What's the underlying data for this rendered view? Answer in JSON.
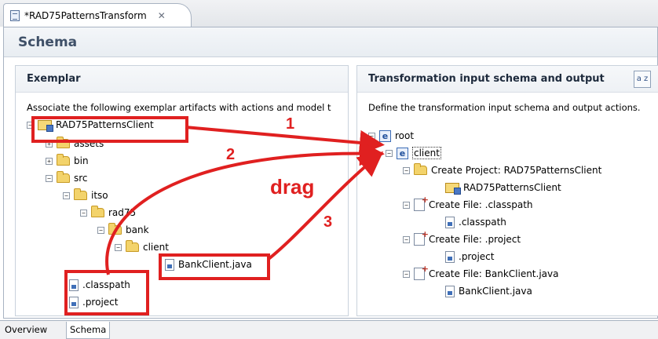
{
  "editor_tab": {
    "title": "*RAD75PatternsTransform",
    "icon": "document-icon",
    "close_glyph": "✕"
  },
  "form": {
    "title": "Schema"
  },
  "left_section": {
    "heading": "Exemplar",
    "description": "Associate the following exemplar artifacts with actions and model t",
    "tree": [
      {
        "label": "RAD75PatternsClient",
        "icon": "project-icon",
        "expander": "−"
      },
      {
        "label": "assets",
        "icon": "folder-icon",
        "expander": "+"
      },
      {
        "label": "bin",
        "icon": "folder-icon",
        "expander": "+"
      },
      {
        "label": "src",
        "icon": "folder-icon",
        "expander": "−"
      },
      {
        "label": "itso",
        "icon": "folder-icon",
        "expander": "−"
      },
      {
        "label": "rad75",
        "icon": "folder-icon",
        "expander": "−"
      },
      {
        "label": "bank",
        "icon": "folder-icon",
        "expander": "−"
      },
      {
        "label": "client",
        "icon": "folder-icon",
        "expander": "−"
      },
      {
        "label": "BankClient.java",
        "icon": "java-file-icon"
      },
      {
        "label": ".classpath",
        "icon": "file-icon"
      },
      {
        "label": ".project",
        "icon": "file-icon"
      }
    ]
  },
  "right_section": {
    "heading": "Transformation input schema and output",
    "sort_button": "a z",
    "description": "Define the transformation input schema and output actions.",
    "tree": [
      {
        "label": "root",
        "icon": "element-icon",
        "expander": "−"
      },
      {
        "label": "client",
        "icon": "element-icon",
        "expander": "−"
      },
      {
        "label": "Create Project: RAD75PatternsClient",
        "icon": "create-project-icon",
        "expander": "−"
      },
      {
        "label": "RAD75PatternsClient",
        "icon": "project-icon"
      },
      {
        "label": "Create File: .classpath",
        "icon": "create-file-icon",
        "expander": "−"
      },
      {
        "label": ".classpath",
        "icon": "file-icon"
      },
      {
        "label": "Create File: .project",
        "icon": "create-file-icon",
        "expander": "−"
      },
      {
        "label": ".project",
        "icon": "file-icon"
      },
      {
        "label": "Create File: BankClient.java",
        "icon": "create-file-icon",
        "expander": "−"
      },
      {
        "label": "BankClient.java",
        "icon": "java-file-icon"
      }
    ],
    "element_letter": "e"
  },
  "annotations": {
    "step1": "1",
    "step2": "2",
    "step3": "3",
    "drag": "drag",
    "color": "#e02020"
  },
  "bottom_tabs": [
    {
      "label": "Overview",
      "active": false
    },
    {
      "label": "Schema",
      "active": true
    }
  ]
}
